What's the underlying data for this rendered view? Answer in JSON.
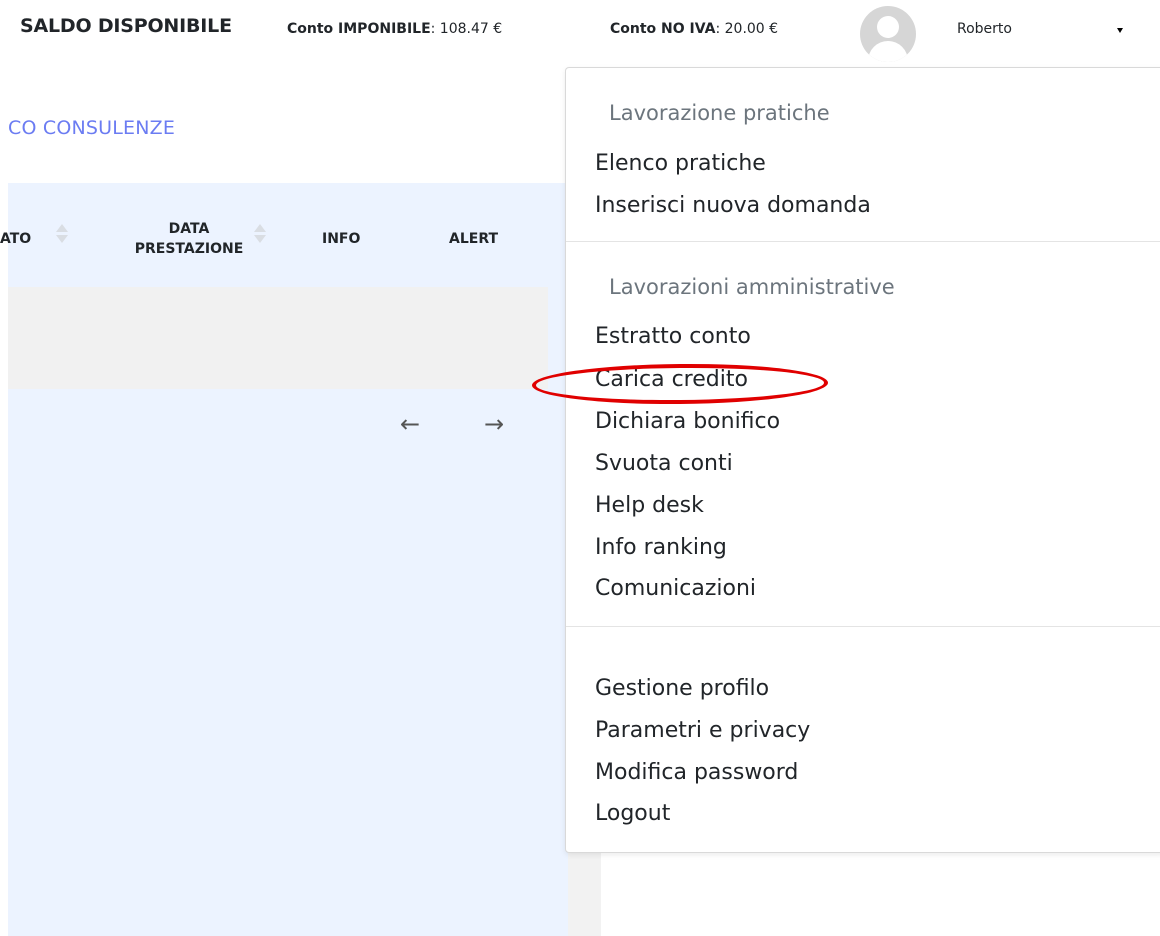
{
  "topbar": {
    "saldo_label": "SALDO DISPONIBILE",
    "conto_imponibile_label": "Conto IMPONIBILE",
    "conto_imponibile_value": ": 108.47 €",
    "conto_noiva_label": "Conto NO IVA",
    "conto_noiva_value": ": 20.00 €",
    "username": "Roberto"
  },
  "page": {
    "title": "CO CONSULENZE",
    "table": {
      "columns": [
        "ATO",
        "DATA PRESTAZIONE",
        "INFO",
        "ALERT"
      ],
      "data_col_line1": "DATA",
      "data_col_line2": "PRESTAZIONE"
    },
    "pager": {
      "prev": "←",
      "next": "→"
    }
  },
  "dropdown": {
    "section1_header": "Lavorazione pratiche",
    "section1_items": [
      "Elenco pratiche",
      "Inserisci nuova domanda"
    ],
    "section2_header": "Lavorazioni amministrative",
    "section2_items": [
      "Estratto conto",
      "Carica credito",
      "Dichiara bonifico",
      "Svuota conti",
      "Help desk",
      "Info ranking",
      "Comunicazioni"
    ],
    "section3_items": [
      "Gestione profilo",
      "Parametri e privacy",
      "Modifica password",
      "Logout"
    ]
  },
  "colors": {
    "accent": "#6b7cf2",
    "table_bg": "#ecf3ff",
    "highlight": "#e00000"
  }
}
